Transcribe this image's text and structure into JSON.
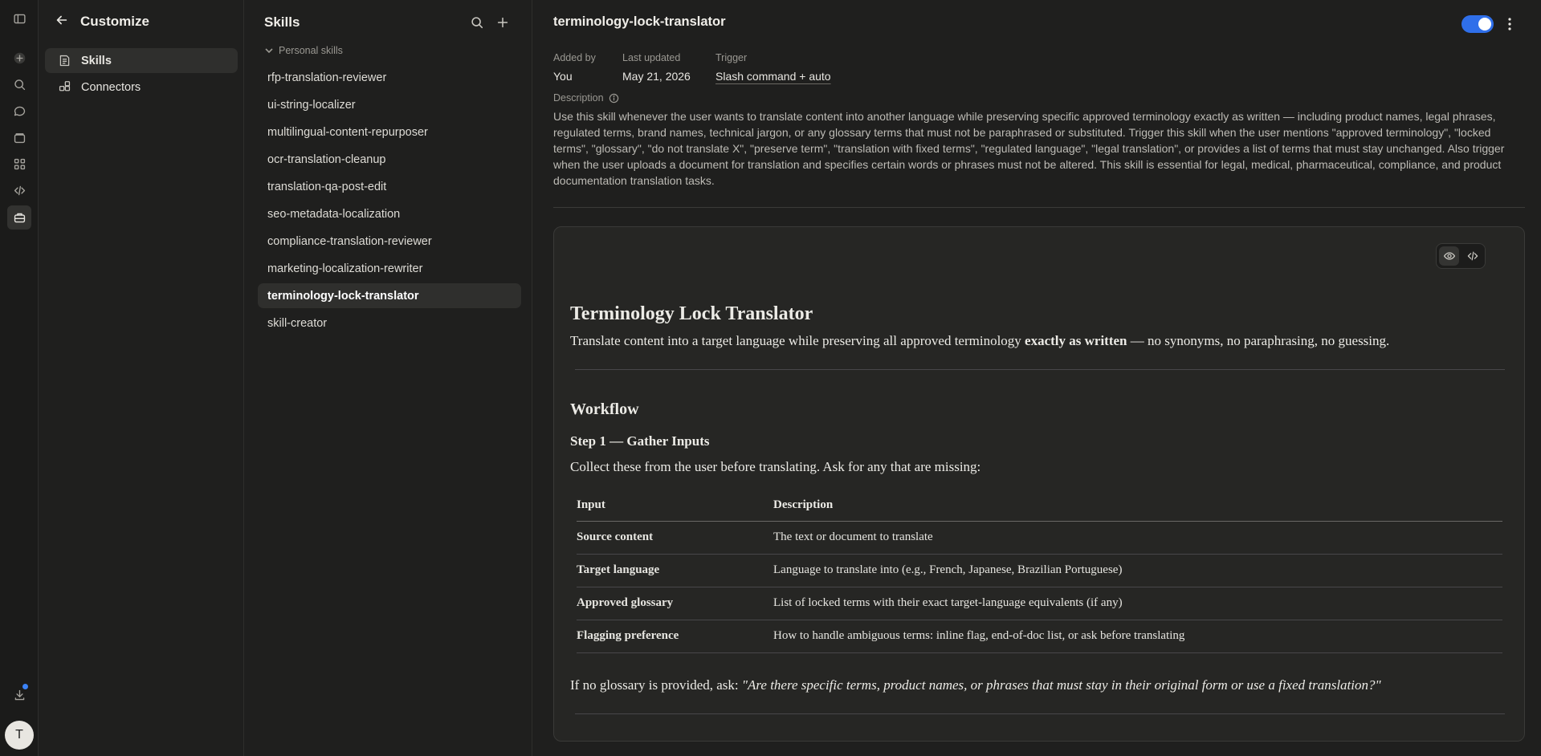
{
  "rail": {
    "icons": [
      "sidebar-toggle-icon",
      "new-chat-icon",
      "search-icon",
      "chats-icon",
      "projects-icon",
      "artifacts-icon",
      "code-icon",
      "customize-icon",
      "download-icon"
    ],
    "avatar_initial": "T"
  },
  "customize": {
    "title": "Customize",
    "items": [
      {
        "label": "Skills",
        "icon": "skills-icon",
        "active": true
      },
      {
        "label": "Connectors",
        "icon": "connectors-icon",
        "active": false
      }
    ]
  },
  "skills_panel": {
    "title": "Skills",
    "group_label": "Personal skills",
    "skills": [
      "rfp-translation-reviewer",
      "ui-string-localizer",
      "multilingual-content-repurposer",
      "ocr-translation-cleanup",
      "translation-qa-post-edit",
      "seo-metadata-localization",
      "compliance-translation-reviewer",
      "marketing-localization-rewriter",
      "terminology-lock-translator",
      "skill-creator"
    ],
    "active_skill": "terminology-lock-translator"
  },
  "detail": {
    "title": "terminology-lock-translator",
    "enabled": true,
    "added_by_label": "Added by",
    "added_by": "You",
    "last_updated_label": "Last updated",
    "last_updated": "May 21, 2026",
    "trigger_label": "Trigger",
    "trigger": "Slash command + auto",
    "description_label": "Description",
    "description": "Use this skill whenever the user wants to translate content into another language while preserving specific approved terminology exactly as written — including product names, legal phrases, regulated terms, brand names, technical jargon, or any glossary terms that must not be paraphrased or substituted. Trigger this skill when the user mentions \"approved terminology\", \"locked terms\", \"glossary\", \"do not translate X\", \"preserve term\", \"translation with fixed terms\", \"regulated language\", \"legal translation\", or provides a list of terms that must stay unchanged. Also trigger when the user uploads a document for translation and specifies certain words or phrases must not be altered. This skill is essential for legal, medical, pharmaceutical, compliance, and product documentation translation tasks."
  },
  "doc": {
    "h1": "Terminology Lock Translator",
    "intro_before": "Translate content into a target language while preserving all approved terminology ",
    "intro_bold": "exactly as written",
    "intro_after": " — no synonyms, no paraphrasing, no guessing.",
    "h2": "Workflow",
    "h3": "Step 1 — Gather Inputs",
    "lead": "Collect these from the user before translating. Ask for any that are missing:",
    "table": {
      "headers": [
        "Input",
        "Description"
      ],
      "rows": [
        [
          "Source content",
          "The text or document to translate"
        ],
        [
          "Target language",
          "Language to translate into (e.g., French, Japanese, Brazilian Portuguese)"
        ],
        [
          "Approved glossary",
          "List of locked terms with their exact target-language equivalents (if any)"
        ],
        [
          "Flagging preference",
          "How to handle ambiguous terms: inline flag, end-of-doc list, or ask before translating"
        ]
      ]
    },
    "ask_before": "If no glossary is provided, ask: ",
    "ask_italic": "\"Are there specific terms, product names, or phrases that must stay in their original form or use a fixed translation?\""
  },
  "colors": {
    "background": "#1f1f1e",
    "accent": "#2f6fea",
    "notification": "#3b82f6"
  }
}
